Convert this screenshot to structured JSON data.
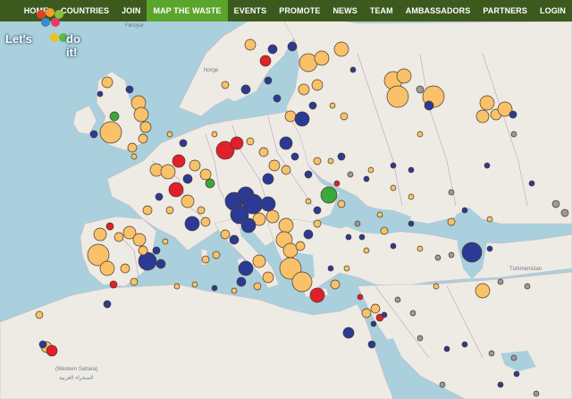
{
  "nav": {
    "items": [
      "HOME",
      "COUNTRIES",
      "JOIN",
      "MAP THE WASTE",
      "EVENTS",
      "PROMOTE",
      "NEWS",
      "TEAM",
      "AMBASSADORS",
      "PARTNERS",
      "LOGIN"
    ],
    "active_index": 3
  },
  "logo": {
    "line1": "Let's",
    "line2": "do it!"
  },
  "map_labels": {
    "western_sahara": "(Western Sahara)",
    "western_sahara_ar": "الصحراء الغربية",
    "turkmenistan": "Turkmenistan",
    "norway": "Norge",
    "faroe": "Føroyar"
  },
  "colors": {
    "nav_bg": "#3c5a1e",
    "nav_active": "#5aa52b",
    "sea": "#a9d0dc",
    "land": "#eeebe4",
    "dot_orange": "#f8c16a",
    "dot_blue": "#2a3a96",
    "dot_red": "#e0202a",
    "dot_green": "#3aa83a",
    "dot_gray": "#9a9a9a"
  },
  "legend_icons": [
    "map-marker-orange-icon",
    "map-marker-blue-icon",
    "map-marker-red-icon",
    "map-marker-green-icon"
  ]
}
